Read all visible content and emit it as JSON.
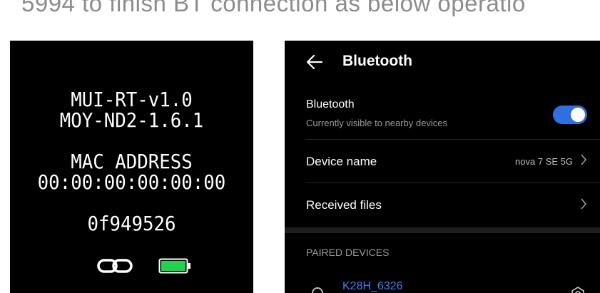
{
  "caption": "5994 to finish BT connection as below operatio",
  "device": {
    "line1": "MUI-RT-v1.0",
    "line2": "MOY-ND2-1.6.1",
    "mac_label": "MAC ADDRESS",
    "mac_value": "00:00:00:00:00:00",
    "code": "0f949526",
    "icons": [
      "link-icon",
      "battery-icon"
    ],
    "battery_color": "#22d14e"
  },
  "phone": {
    "title": "Bluetooth",
    "bluetooth_row": {
      "title": "Bluetooth",
      "subtitle": "Currently visible to nearby devices",
      "toggle_on": true,
      "toggle_color": "#2f6fe0"
    },
    "device_name_row": {
      "title": "Device name",
      "value": "nova 7 SE 5G"
    },
    "received_files_row": {
      "title": "Received files"
    },
    "paired_header": "PAIRED DEVICES",
    "paired_devices": [
      {
        "name": "K28H_6326",
        "name_color": "#3a82f7"
      }
    ]
  }
}
